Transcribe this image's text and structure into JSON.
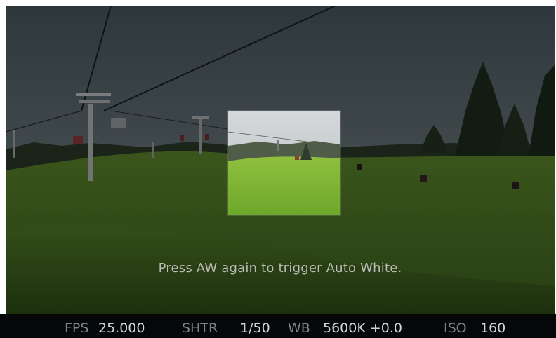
{
  "viewfinder": {
    "message": "Press AW again to trigger Auto White."
  },
  "status_bar": {
    "fps_label": "FPS",
    "fps_value": "25.000",
    "shutter_label": "SHTR",
    "shutter_value": "1/50",
    "wb_label": "WB",
    "wb_value": "5600K +0.0",
    "iso_label": "ISO",
    "iso_value": "160"
  },
  "colors": {
    "status_bar_bg": "#060708",
    "status_label": "#7d838c",
    "status_value": "#d3d6da",
    "message_text": "#b9bcb6"
  }
}
